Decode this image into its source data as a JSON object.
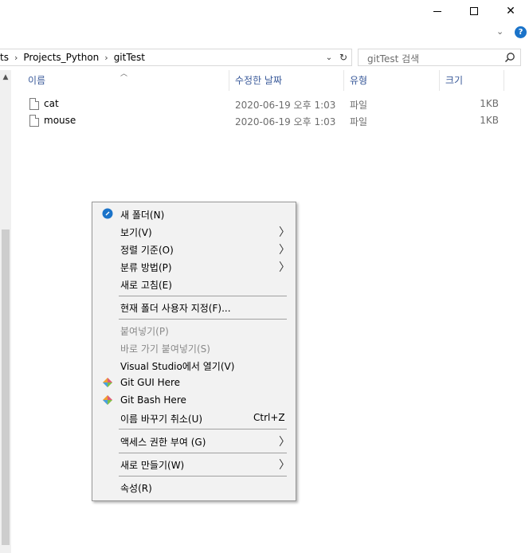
{
  "window": {
    "minimize_icon": "minimize-icon",
    "maximize_icon": "maximize-icon",
    "close_icon": "close-icon",
    "close_glyph": "✕",
    "ribbon_chevron": "⌄",
    "help": "?"
  },
  "address": {
    "crumbs": [
      "ts",
      "Projects_Python",
      "gitTest"
    ],
    "separator": "›",
    "dropdown": "⌄",
    "refresh": "↻"
  },
  "search": {
    "placeholder": "gitTest 검색"
  },
  "columns": {
    "name": "이름",
    "date": "수정한 날짜",
    "type": "유형",
    "size": "크기"
  },
  "files": [
    {
      "name": "cat",
      "date": "2020-06-19 오후 1:03",
      "type": "파일",
      "size": "1KB"
    },
    {
      "name": "mouse",
      "date": "2020-06-19 오후 1:03",
      "type": "파일",
      "size": "1KB"
    }
  ],
  "context_menu": {
    "items": [
      {
        "label": "새 폴더(N)",
        "icon": "new-folder-icon"
      },
      {
        "label": "보기(V)",
        "arrow": "〉"
      },
      {
        "label": "정렬 기준(O)",
        "arrow": "〉"
      },
      {
        "label": "분류 방법(P)",
        "arrow": "〉"
      },
      {
        "label": "새로 고침(E)"
      },
      {
        "label": "현재 폴더 사용자 지정(F)..."
      },
      {
        "label": "붙여넣기(P)",
        "disabled": true
      },
      {
        "label": "바로 가기 붙여넣기(S)",
        "disabled": true
      },
      {
        "label": "Visual Studio에서 열기(V)"
      },
      {
        "label": "Git GUI Here",
        "icon": "git-icon"
      },
      {
        "label": "Git Bash Here",
        "icon": "git-icon"
      },
      {
        "label": "이름 바꾸기 취소(U)",
        "shortcut": "Ctrl+Z"
      },
      {
        "label": "액세스 권한 부여 (G)",
        "arrow": "〉"
      },
      {
        "label": "새로 만들기(W)",
        "arrow": "〉"
      },
      {
        "label": "속성(R)"
      }
    ]
  },
  "colors": {
    "accent": "#1a73c9",
    "header_text": "#3a5a9a",
    "menu_bg": "#f2f2f2"
  }
}
